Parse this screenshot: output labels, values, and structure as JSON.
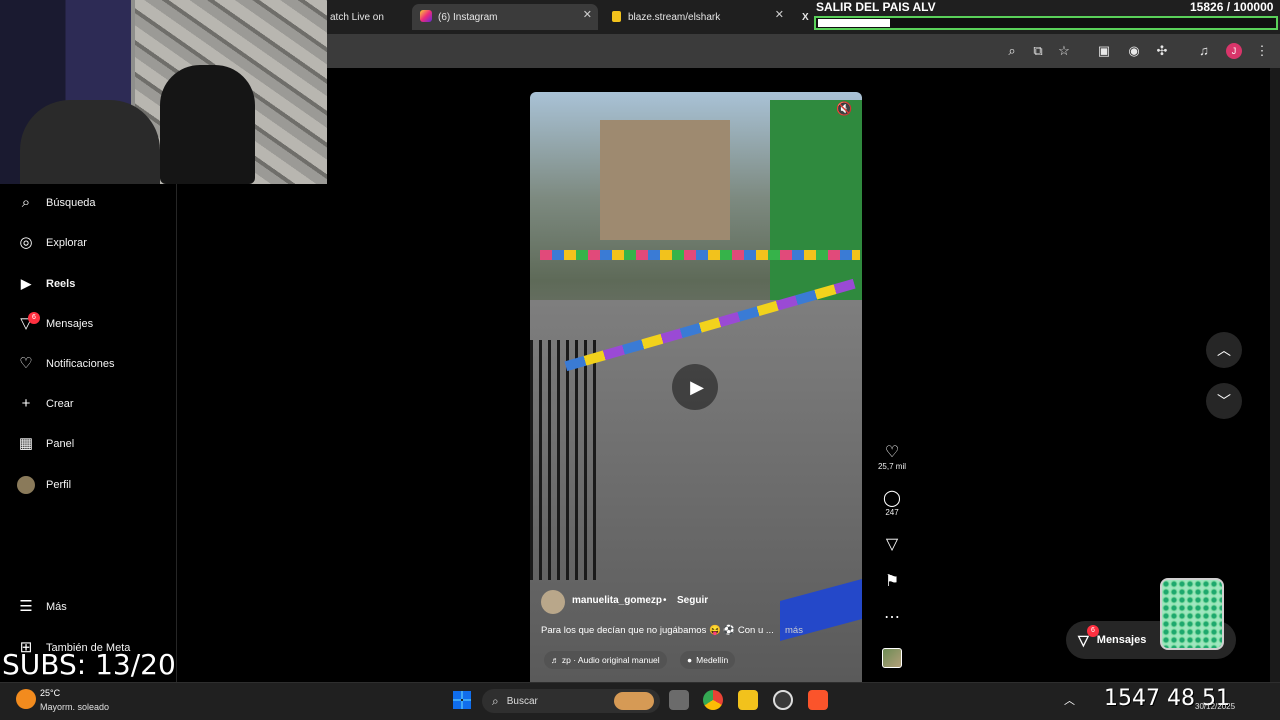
{
  "browser": {
    "tabs": [
      {
        "label": "atch Live on"
      },
      {
        "label": "(6) Instagram"
      },
      {
        "label": "blaze.stream/elshark"
      },
      {
        "label": "X"
      }
    ],
    "avatar_letter": "J"
  },
  "overlay": {
    "goal_title": "SALIR DEL PAIS ALV",
    "goal_count": "15826 / 100000",
    "goal_progress": 0.158,
    "subs": "SUBS: 13/20"
  },
  "sidebar": {
    "items": [
      {
        "label": "Búsqueda",
        "icon": "search-icon"
      },
      {
        "label": "Explorar",
        "icon": "compass-icon"
      },
      {
        "label": "Reels",
        "icon": "reels-icon"
      },
      {
        "label": "Mensajes",
        "icon": "messenger-icon",
        "badge": "6"
      },
      {
        "label": "Notificaciones",
        "icon": "heart-icon"
      },
      {
        "label": "Crear",
        "icon": "plus-icon"
      },
      {
        "label": "Panel",
        "icon": "dashboard-icon"
      },
      {
        "label": "Perfil",
        "icon": "avatar-icon"
      }
    ],
    "more": "Más",
    "meta": "También de Meta"
  },
  "reel": {
    "author": "manuelita_gomezp",
    "separator": "•",
    "follow": "Seguir",
    "caption": "Para los que decían que no jugábamos 😝 ⚽ Con u ...",
    "more": "más",
    "audio": "♬ zp · Audio original  manuel",
    "location": "Medellín",
    "likes": "25,7 mil",
    "comments": "247"
  },
  "messages_pill": {
    "label": "Mensajes",
    "badge": "6"
  },
  "taskbar": {
    "temperature": "25°C",
    "weather": "Mayorm. soleado",
    "search_placeholder": "Buscar",
    "clock_big": "1547 48 51",
    "date": "30/12/2025"
  },
  "colors": {
    "accent_notification": "#ff3040",
    "goal_bar_border": "#5ad15a",
    "browser_tab_active": "#3b3b3b"
  }
}
